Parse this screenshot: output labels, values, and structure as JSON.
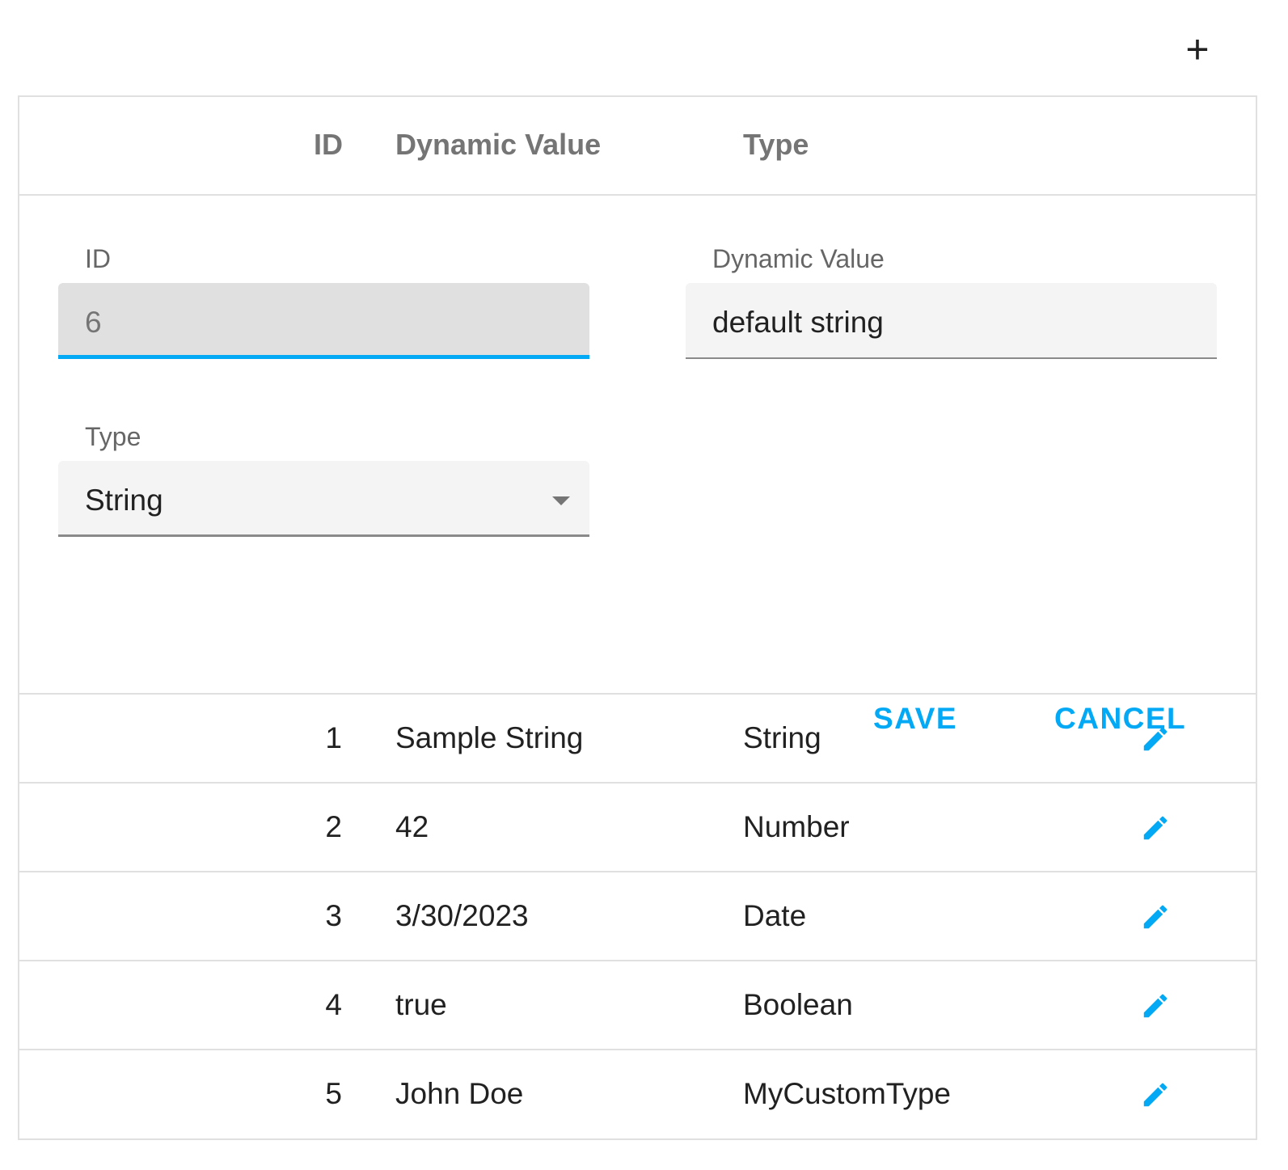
{
  "toolbar": {
    "add_icon": "plus-icon",
    "add_label": "+"
  },
  "columns": {
    "id": "ID",
    "value": "Dynamic Value",
    "type": "Type"
  },
  "form": {
    "id_label": "ID",
    "id_value": "6",
    "value_label": "Dynamic Value",
    "value_value": "default string",
    "type_label": "Type",
    "type_value": "String",
    "save": "SAVE",
    "cancel": "CANCEL"
  },
  "rows": [
    {
      "id": "1",
      "value": "Sample String",
      "type": "String"
    },
    {
      "id": "2",
      "value": "42",
      "type": "Number"
    },
    {
      "id": "3",
      "value": "3/30/2023",
      "type": "Date"
    },
    {
      "id": "4",
      "value": "true",
      "type": "Boolean"
    },
    {
      "id": "5",
      "value": "John Doe",
      "type": "MyCustomType"
    }
  ],
  "colors": {
    "accent": "#03a9f4"
  }
}
